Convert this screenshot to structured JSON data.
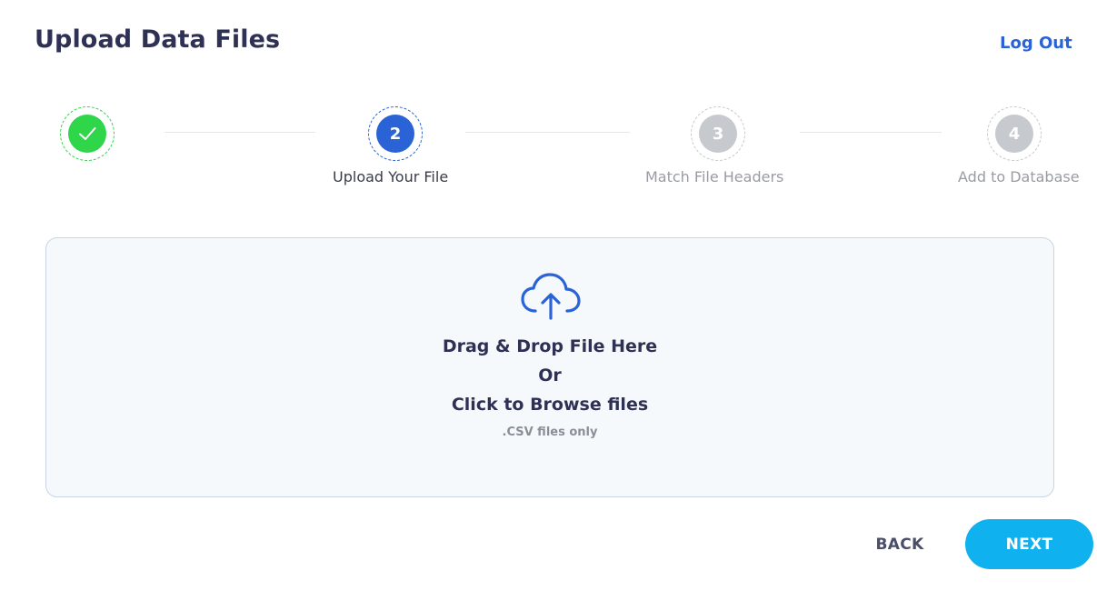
{
  "header": {
    "title": "Upload Data Files",
    "logout_label": "Log Out"
  },
  "stepper": {
    "steps": [
      {
        "number": "",
        "label": "",
        "status": "completed",
        "icon": "check-icon"
      },
      {
        "number": "2",
        "label": "Upload Your File",
        "status": "active"
      },
      {
        "number": "3",
        "label": "Match File Headers",
        "status": "pending"
      },
      {
        "number": "4",
        "label": "Add to Database",
        "status": "pending"
      }
    ]
  },
  "dropzone": {
    "icon": "cloud-upload-icon",
    "line1": "Drag & Drop File Here",
    "line2": "Or",
    "line3": "Click to Browse files",
    "note": ".CSV files only"
  },
  "footer": {
    "back_label": "BACK",
    "next_label": "NEXT"
  },
  "colors": {
    "completed": "#2fd64a",
    "active": "#2a63d6",
    "pending": "#c6c9ce",
    "next_button": "#0fb2ee",
    "link": "#2a63d6"
  }
}
